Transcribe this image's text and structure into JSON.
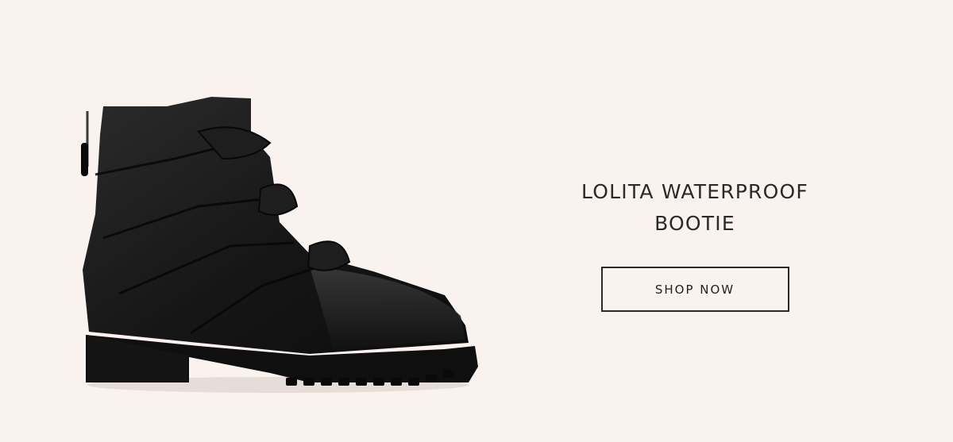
{
  "banner": {
    "title_line1": "LOLITA WATERPROOF",
    "title_line2": "BOOTIE",
    "cta_label": "SHOP NOW",
    "product_image_alt": "black leather ankle boot with knotted straps"
  },
  "colors": {
    "background": "#f9f2ef",
    "text": "#2a2a2a",
    "boot": "#1b1b1b"
  }
}
